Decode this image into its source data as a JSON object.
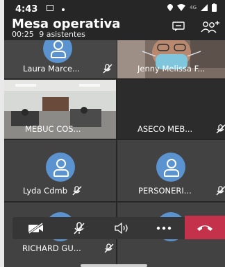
{
  "status_bar": {
    "time": "4:43",
    "signal_text": "4G"
  },
  "meeting": {
    "title": "Mesa operativa",
    "duration": "00:25",
    "attendees": "9 asistentes"
  },
  "participants": [
    {
      "name": "Laura Marce...",
      "video": false
    },
    {
      "name": "Jenny Melissa F...",
      "video": true
    },
    {
      "name": "MEBUC COS...",
      "video": true
    },
    {
      "name": "ASECO MEB...",
      "video": false
    },
    {
      "name": "Lyda Cdmb",
      "video": false
    },
    {
      "name": "PERSONERI...",
      "video": false
    },
    {
      "name": "RICHARD GU...",
      "video": false
    }
  ],
  "controls": [
    "camera-off",
    "mic-off",
    "speaker",
    "more",
    "hang-up"
  ],
  "colors": {
    "background": "#262626",
    "tile": "#424242",
    "avatar": "#5a93cf",
    "hangup": "#c4314b"
  }
}
